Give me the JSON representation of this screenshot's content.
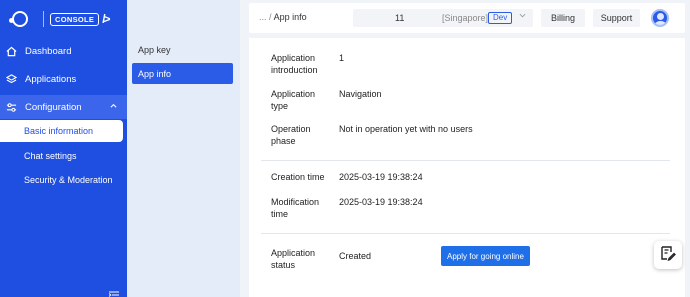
{
  "sidebar": {
    "logo_text": "CONSOLE",
    "items": [
      {
        "label": "Dashboard",
        "icon": "home-icon"
      },
      {
        "label": "Applications",
        "icon": "layers-icon"
      },
      {
        "label": "Configuration",
        "icon": "sliders-icon"
      }
    ],
    "subitems": [
      {
        "label": "Basic information"
      },
      {
        "label": "Chat settings"
      },
      {
        "label": "Security & Moderation"
      }
    ]
  },
  "subnav": {
    "items": [
      {
        "label": "App key"
      },
      {
        "label": "App info"
      }
    ]
  },
  "topbar": {
    "breadcrumb_ellipsis": "...",
    "breadcrumb_sep": "/",
    "breadcrumb_current": "App info",
    "instance_id": "11",
    "region": "[Singapore]",
    "env": "Dev",
    "billing_label": "Billing",
    "support_label": "Support"
  },
  "info": {
    "intro_label": "Application introduction",
    "intro_value": "1",
    "type_label": "Application type",
    "type_value": "Navigation",
    "phase_label": "Operation phase",
    "phase_value": "Not in operation yet with no users",
    "created_label": "Creation time",
    "created_value": "2025-03-19 19:38:24",
    "modified_label": "Modification time",
    "modified_value": "2025-03-19 19:38:24",
    "status_label": "Application status",
    "status_value": "Created",
    "apply_label": "Apply for going online"
  },
  "colors": {
    "sidebar": "#1f4fe0",
    "accent": "#2a5ce8",
    "button": "#1f6fe8"
  }
}
